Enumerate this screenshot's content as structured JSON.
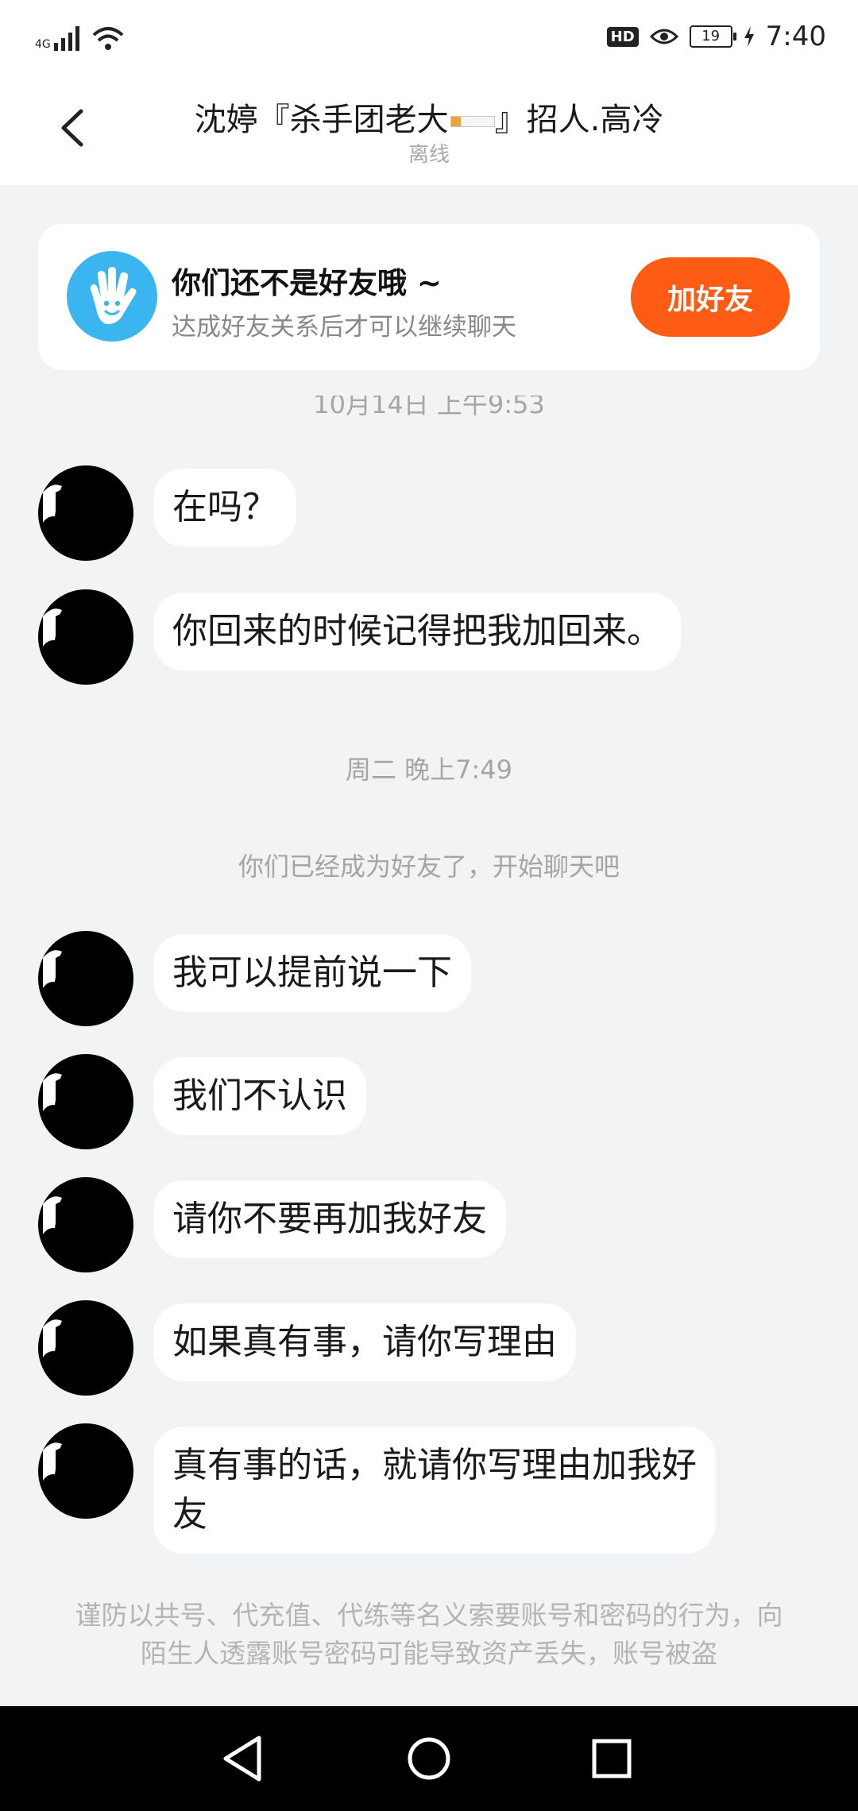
{
  "status_bar": {
    "network": "4G",
    "hd": "HD",
    "battery": "19",
    "time": "7:40"
  },
  "header": {
    "title_prefix": "沈婷『杀手团老大",
    "title_suffix": "』招人.高冷",
    "subtitle": "离线"
  },
  "banner": {
    "title": "你们还不是好友哦 ~",
    "subtitle": "达成好友关系后才可以继续聊天",
    "add_button": "加好友"
  },
  "chat": {
    "partial_timestamp": "10月14日 上午9:53",
    "messages_1": [
      "在吗？",
      "你回来的时候记得把我加回来。"
    ],
    "timestamp_2": "周二 晚上7:49",
    "system_notice": "你们已经成为好友了，开始聊天吧",
    "messages_2": [
      "我可以提前说一下",
      "我们不认识",
      "请你不要再加我好友",
      "如果真有事，请你写理由",
      "真有事的话，就请你写理由加我好友"
    ]
  },
  "warning": "谨防以共号、代充值、代练等名义索要账号和密码的行为，向陌生人透露账号密码可能导致资产丢失，账号被盗",
  "colors": {
    "accent": "#fe5b14",
    "icon_blue": "#3bb5ef",
    "background": "#f2f3f5"
  }
}
